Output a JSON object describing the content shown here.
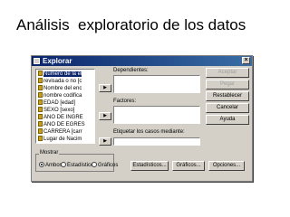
{
  "slide": {
    "title": "Análisis  exploratorio de los datos"
  },
  "dialog": {
    "title": "Explorar",
    "close_label": "×",
    "variables": [
      {
        "label": "Número de la el",
        "selected": true
      },
      {
        "label": "revisada o no [c",
        "selected": false
      },
      {
        "label": "Nombre del enc",
        "selected": false
      },
      {
        "label": "nombre codifica",
        "selected": false
      },
      {
        "label": "EDAD [edad]",
        "selected": false
      },
      {
        "label": "SEXO [sexo]",
        "selected": false
      },
      {
        "label": "AÑO DE INGRE",
        "selected": false
      },
      {
        "label": "AÑO DE EGRES",
        "selected": false
      },
      {
        "label": "CARRERA [carr",
        "selected": false
      },
      {
        "label": "Lugar de Nacim",
        "selected": false
      }
    ],
    "arrow_label": "▶",
    "dependientes_label": "Dependientes:",
    "factores_label": "Factores:",
    "etiquetar_label": "Etiquetar los casos mediante:",
    "side_buttons": [
      {
        "label": "Aceptar",
        "enabled": false
      },
      {
        "label": "Pegar",
        "enabled": false
      },
      {
        "label": "Restablecer",
        "enabled": true
      },
      {
        "label": "Cancelar",
        "enabled": true
      },
      {
        "label": "Ayuda",
        "enabled": true
      }
    ],
    "mostrar": {
      "title": "Mostrar",
      "options": [
        {
          "label": "Ambos",
          "checked": true
        },
        {
          "label": "Estadísticos",
          "checked": false
        },
        {
          "label": "Gráficos",
          "checked": false
        }
      ]
    },
    "bottom_buttons": [
      "Estadísticos...",
      "Gráficos...",
      "Opciones..."
    ]
  }
}
